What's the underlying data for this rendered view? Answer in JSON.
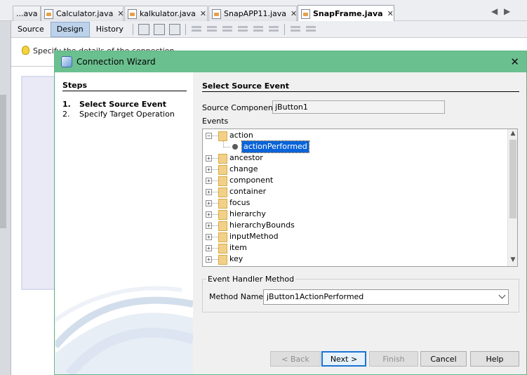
{
  "editor": {
    "tabs": [
      {
        "label": "...ava"
      },
      {
        "label": "Calculator.java"
      },
      {
        "label": "kalkulator.java"
      },
      {
        "label": "SnapAPP11.java"
      },
      {
        "label": "SnapFrame.java"
      }
    ],
    "close_glyph": "✕",
    "nav_left": "◀",
    "nav_right": "▶",
    "views": [
      "Source",
      "Design",
      "History"
    ],
    "hint_text": "Specify the details of the connection",
    "icons": [
      "selection-mode-icon",
      "connection-mode-icon",
      "preview-design-icon",
      "align-icon",
      "resize-icon"
    ]
  },
  "dialog": {
    "title": "Connection Wizard",
    "close_glyph": "✕",
    "steps": {
      "title": "Steps",
      "items": [
        {
          "num": "1.",
          "label": "Select Source Event"
        },
        {
          "num": "2.",
          "label": "Specify Target Operation"
        }
      ]
    },
    "main_title": "Select Source Event",
    "source_component": {
      "label": "Source Component:",
      "value": "jButton1"
    },
    "events_label": "Events",
    "events_tree": {
      "expanded": {
        "label": "action",
        "toggle": "−",
        "child": "actionPerformed"
      },
      "collapsed": [
        "ancestor",
        "change",
        "component",
        "container",
        "focus",
        "hierarchy",
        "hierarchyBounds",
        "inputMethod",
        "item",
        "key"
      ],
      "collapsed_toggle": "+",
      "scroll_up": "▲",
      "scroll_down": "▼"
    },
    "handler": {
      "group_title": "Event Handler Method",
      "label": "Method Name:",
      "value": "jButton1ActionPerformed"
    },
    "buttons": {
      "back": "< Back",
      "next": "Next >",
      "finish": "Finish",
      "cancel": "Cancel",
      "help": "Help"
    }
  },
  "colors": {
    "titlebar": "#6bc08f",
    "selection": "#0a64d8",
    "design_tab": "#bcd2ea"
  }
}
